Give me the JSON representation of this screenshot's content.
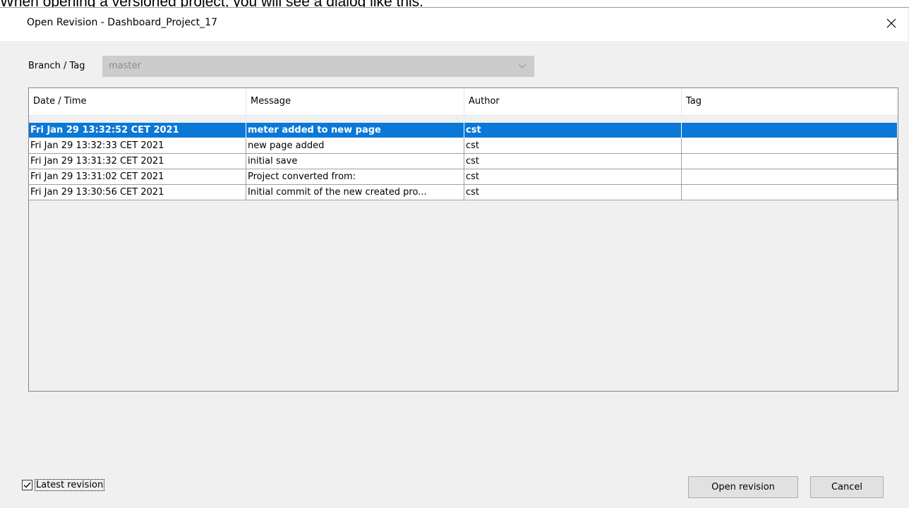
{
  "page_text": "When opening a versioned project, you will see a dialog like this:",
  "dialog": {
    "title": "Open Revision - Dashboard_Project_17",
    "branch_label": "Branch / Tag",
    "branch_value": "master",
    "columns": [
      "Date / Time",
      "Message",
      "Author",
      "Tag"
    ],
    "rows": [
      {
        "date": "Fri Jan 29 13:32:52 CET 2021",
        "message": "meter added to new page",
        "author": "cst",
        "tag": "",
        "selected": true
      },
      {
        "date": "Fri Jan 29 13:32:33 CET 2021",
        "message": "new page added",
        "author": "cst",
        "tag": ""
      },
      {
        "date": "Fri Jan 29 13:31:32 CET 2021",
        "message": "initial save",
        "author": "cst",
        "tag": ""
      },
      {
        "date": "Fri Jan 29 13:31:02 CET 2021",
        "message": "Project converted from:",
        "author": "cst",
        "tag": ""
      },
      {
        "date": "Fri Jan 29 13:30:56 CET 2021",
        "message": "Initial commit of the new created pro...",
        "author": "cst",
        "tag": ""
      }
    ],
    "latest_revision_label": "Latest revision",
    "latest_revision_checked": true,
    "open_button": "Open revision",
    "cancel_button": "Cancel"
  },
  "colors": {
    "selection": "#0a78d7",
    "dialog_bg": "#f0f0f0",
    "disabled_combo": "#cccccc"
  },
  "icons": {
    "close": "close-icon",
    "dropdown": "chevron-down-icon",
    "checkbox": "checkmark-icon"
  }
}
